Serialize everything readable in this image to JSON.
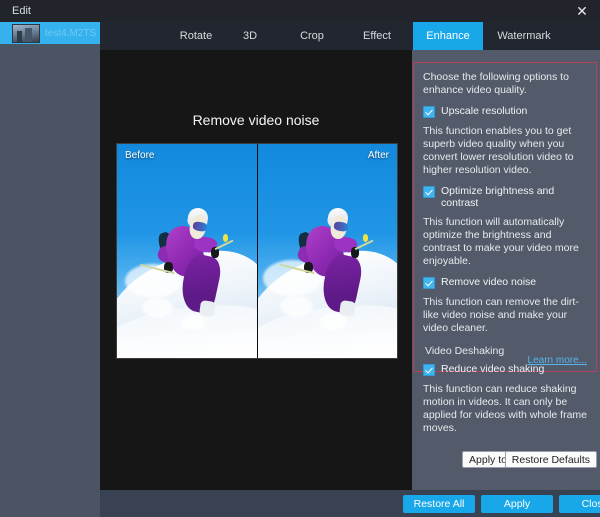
{
  "window": {
    "title": "Edit",
    "close_icon": "close-icon"
  },
  "sidebar": {
    "files": [
      {
        "name": "test4.M2TS",
        "thumbnail_icon": "video-thumbnail-icon",
        "selected": true
      }
    ]
  },
  "tabs": [
    {
      "label": "Rotate",
      "active": false
    },
    {
      "label": "3D",
      "active": false
    },
    {
      "label": "Crop",
      "active": false
    },
    {
      "label": "Effect",
      "active": false
    },
    {
      "label": "Enhance",
      "active": true
    },
    {
      "label": "Watermark",
      "active": false
    }
  ],
  "preview": {
    "title": "Remove video noise",
    "before_label": "Before",
    "after_label": "After"
  },
  "options_panel": {
    "intro": "Choose the following options to enhance video quality.",
    "items": [
      {
        "label": "Upscale resolution",
        "checked": true,
        "description": "This function enables you to get superb video quality when you convert lower resolution video to higher resolution video."
      },
      {
        "label": "Optimize brightness and contrast",
        "checked": true,
        "description": "This function will automatically optimize the brightness and contrast to make your video more enjoyable."
      },
      {
        "label": "Remove video noise",
        "checked": true,
        "description": "This function can remove the dirt-like video noise and make your video cleaner."
      }
    ],
    "section_label": "Video Deshaking",
    "deshake": {
      "label": "Reduce video shaking",
      "checked": true,
      "description": "This function can reduce shaking motion in videos. It can only be applied for videos with whole frame moves."
    },
    "learn_more": "Learn more...",
    "highlight_border_color": "#b6405a"
  },
  "panel_buttons": {
    "apply_to_all": "Apply to All",
    "restore_defaults": "Restore Defaults"
  },
  "bottom_bar": {
    "restore_all": "Restore All",
    "apply": "Apply",
    "close": "Close",
    "accent_color": "#18a7e8"
  }
}
